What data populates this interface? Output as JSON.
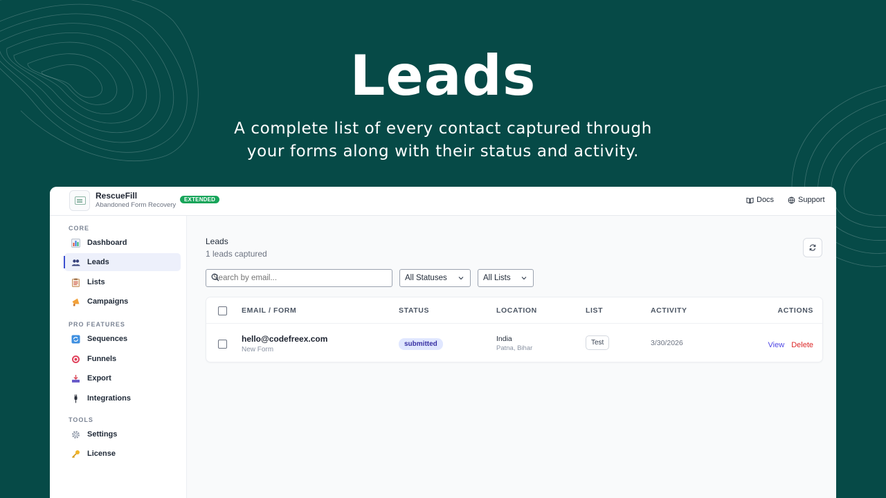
{
  "hero": {
    "title": "Leads",
    "subtitle_line1": "A complete list of every contact captured through",
    "subtitle_line2": "your forms along with their status and activity."
  },
  "app": {
    "brand_name": "RescueFill",
    "brand_tagline": "Abandoned Form Recovery",
    "badge": "EXTENDED",
    "top_links": {
      "docs": "Docs",
      "support": "Support"
    }
  },
  "sidebar": {
    "sections": [
      {
        "title": "CORE",
        "items": [
          {
            "label": "Dashboard",
            "icon": "bar-chart-icon",
            "active": false
          },
          {
            "label": "Leads",
            "icon": "users-icon",
            "active": true
          },
          {
            "label": "Lists",
            "icon": "clipboard-icon",
            "active": false
          },
          {
            "label": "Campaigns",
            "icon": "megaphone-icon",
            "active": false
          }
        ]
      },
      {
        "title": "PRO FEATURES",
        "items": [
          {
            "label": "Sequences",
            "icon": "refresh-icon",
            "active": false
          },
          {
            "label": "Funnels",
            "icon": "target-icon",
            "active": false
          },
          {
            "label": "Export",
            "icon": "inbox-tray-icon",
            "active": false
          },
          {
            "label": "Integrations",
            "icon": "plug-icon",
            "active": false
          }
        ]
      },
      {
        "title": "TOOLS",
        "items": [
          {
            "label": "Settings",
            "icon": "gear-icon",
            "active": false
          },
          {
            "label": "License",
            "icon": "key-icon",
            "active": false
          }
        ]
      }
    ]
  },
  "main": {
    "page_title": "Leads",
    "count_text": "1 leads captured",
    "search_placeholder": "Search by email...",
    "status_filter": "All Statuses",
    "list_filter": "All Lists",
    "table": {
      "columns": [
        "EMAIL / FORM",
        "STATUS",
        "LOCATION",
        "LIST",
        "ACTIVITY",
        "ACTIONS"
      ],
      "rows": [
        {
          "email": "hello@codefreex.com",
          "form": "New Form",
          "status": "submitted",
          "country": "India",
          "city": "Patna, Bihar",
          "list": "Test",
          "activity": "3/30/2026",
          "view": "View",
          "delete": "Delete"
        }
      ]
    }
  },
  "colors": {
    "background": "#064a47",
    "accent": "#3b4fd0",
    "badge": "#17a55a",
    "status_bg": "#e0e7ff",
    "delete": "#dc2626"
  }
}
